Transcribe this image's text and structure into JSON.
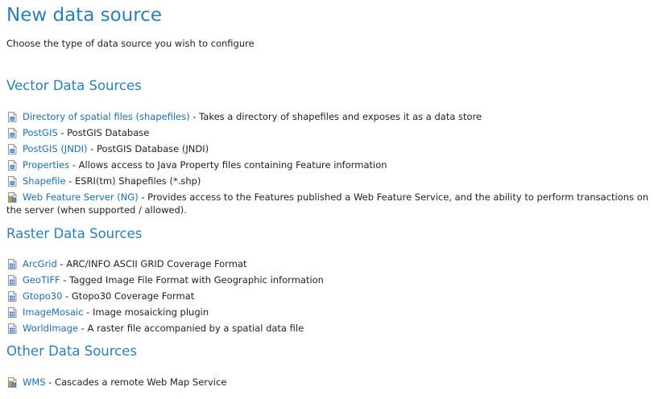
{
  "page": {
    "title": "New data source",
    "subtitle": "Choose the type of data source you wish to configure"
  },
  "colors": {
    "heading": "#2b7fb8",
    "link": "#1c6fb4",
    "text": "#222222"
  },
  "vector": {
    "heading": "Vector Data Sources",
    "items": [
      {
        "icon": "vector-store-icon",
        "name": "Directory of spatial files (shapefiles)",
        "description": " - Takes a directory of shapefiles and exposes it as a data store"
      },
      {
        "icon": "vector-store-icon",
        "name": "PostGIS",
        "description": " - PostGIS Database"
      },
      {
        "icon": "vector-store-icon",
        "name": "PostGIS (JNDI)",
        "description": " - PostGIS Database (JNDI)"
      },
      {
        "icon": "vector-store-icon",
        "name": "Properties",
        "description": " - Allows access to Java Property files containing Feature information"
      },
      {
        "icon": "vector-store-icon",
        "name": "Shapefile",
        "description": " - ESRI(tm) Shapefiles (*.shp)"
      },
      {
        "icon": "remote-server-icon",
        "name": "Web Feature Server (NG)",
        "description": " - Provides access to the Features published a Web Feature Service, and the ability to perform transactions on the server (when supported / allowed)."
      }
    ]
  },
  "raster": {
    "heading": "Raster Data Sources",
    "items": [
      {
        "icon": "raster-store-icon",
        "name": "ArcGrid",
        "description": " - ARC/INFO ASCII GRID Coverage Format"
      },
      {
        "icon": "raster-store-icon",
        "name": "GeoTIFF",
        "description": " - Tagged Image File Format with Geographic information"
      },
      {
        "icon": "raster-store-icon",
        "name": "Gtopo30",
        "description": " - Gtopo30 Coverage Format"
      },
      {
        "icon": "raster-store-icon",
        "name": "ImageMosaic",
        "description": " - Image mosaicking plugin"
      },
      {
        "icon": "raster-store-icon",
        "name": "WorldImage",
        "description": " - A raster file accompanied by a spatial data file"
      }
    ]
  },
  "other": {
    "heading": "Other Data Sources",
    "items": [
      {
        "icon": "remote-server-icon",
        "name": "WMS",
        "description": " - Cascades a remote Web Map Service"
      }
    ]
  }
}
